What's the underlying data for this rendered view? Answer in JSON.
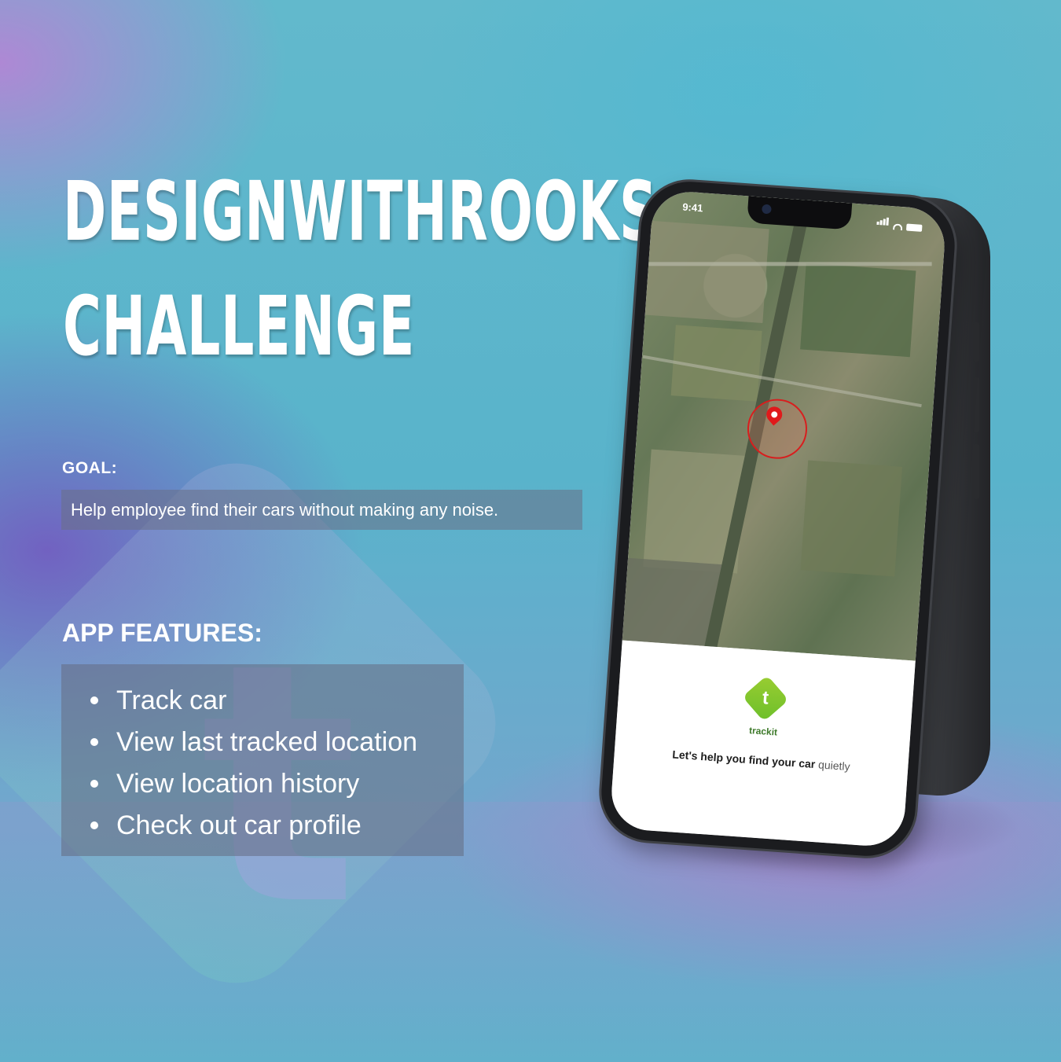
{
  "headline": {
    "line1": "DESIGNWITHROOKS",
    "line2": "CHALLENGE"
  },
  "goal": {
    "label": "GOAL:",
    "text_part1": "Help employee find their cars ",
    "text_part2": "without making any noise."
  },
  "features": {
    "label": "APP FEATURES:",
    "items": [
      "Track car",
      "View last tracked location",
      "View location history",
      "Check out car profile"
    ]
  },
  "phone": {
    "status_time": "9:41",
    "app": {
      "logo_letter": "t",
      "name": "trackit",
      "tagline_bold": "Let's help you find your car",
      "tagline_light": "quietly"
    }
  },
  "colors": {
    "logo_green": "#7ec832",
    "pin_red": "#e0191b",
    "brand_text_green": "#3e7a2b"
  },
  "icons": [
    "map-pin-icon",
    "signal-icon",
    "wifi-icon",
    "battery-icon",
    "trackit-logo-icon"
  ]
}
